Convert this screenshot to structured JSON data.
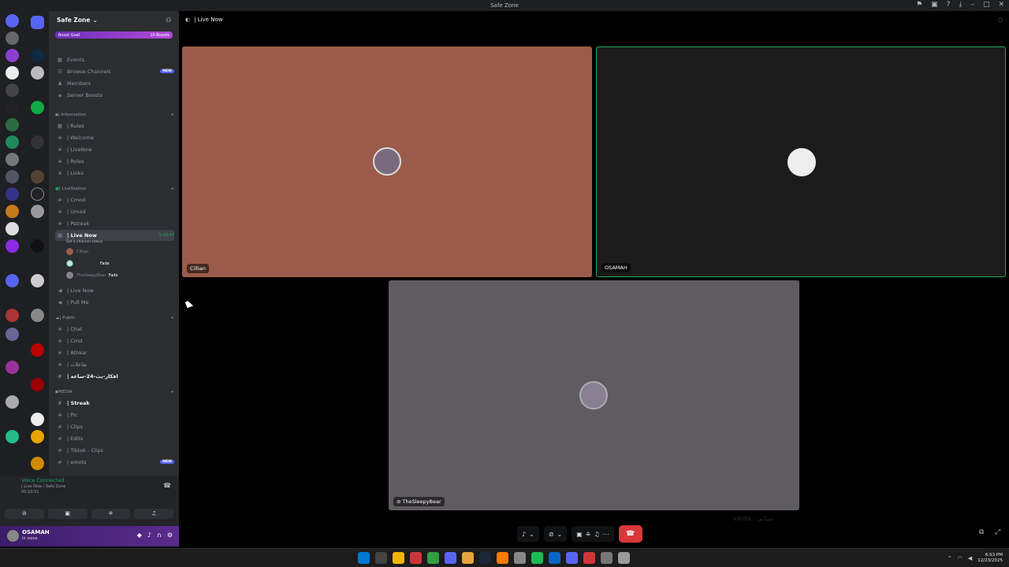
{
  "window": {
    "title": "Safe Zone",
    "controls": [
      "⚑",
      "▣",
      "?",
      "⤓",
      "–",
      "□",
      "✕"
    ]
  },
  "server": {
    "name": "Safe Zone",
    "boost_goal_label": "Boost Goal",
    "boost_count": "10 Boosts",
    "nav": [
      {
        "label": "Events",
        "icon": "calendar-icon"
      },
      {
        "label": "Browse Channels",
        "icon": "browse-icon",
        "badge": "NEW"
      },
      {
        "label": "Members",
        "icon": "members-icon"
      },
      {
        "label": "Server Boosts",
        "icon": "boost-icon"
      }
    ]
  },
  "categories": {
    "information": "| Information",
    "livestation": "| LiveStation",
    "public": "| Public",
    "media": "MEDIA"
  },
  "channels": {
    "rules": "| Rules",
    "welcome": "| Welcome",
    "livenow_text": "| LiveNow",
    "roles": "| Roles",
    "links": "| Links",
    "cmod": "| Cmod",
    "umod": "| Umod",
    "pstreak": "| Pstreak",
    "live_now_voice": "| Live Now",
    "live_now_timer": "5:10:47",
    "live_now_status": "Set a channel status",
    "live_now_2": "| Live Now",
    "pull_me": "| Pull Me",
    "chat": "| Chat",
    "cmd": "| Cmd",
    "athkar": "| Athkar",
    "arabic_1": "| تفاعلات",
    "arabic_2": "| افكار-بث-24-ساعه",
    "streak": "| Streak",
    "pic": "| Pic",
    "clips": "| Clips",
    "edits": "| Edits",
    "tiktok": "| Tiktok - Clips",
    "emots": "| emots",
    "emots_badge": "NEW"
  },
  "voice_users": [
    {
      "name": "Cillian",
      "tag": ""
    },
    {
      "name": "",
      "tag": "Fade"
    },
    {
      "name": "TheSleepyBear",
      "tag": "Fade"
    }
  ],
  "voice_panel": {
    "status": "Voice Connected",
    "channel": "| Live Now / Safe Zone",
    "elapsed": "05:10:51"
  },
  "user_panel": {
    "name": "OSAMAH",
    "status": "In voice"
  },
  "stage": {
    "header": "| Live Now",
    "tiles": [
      {
        "name": "Cillian",
        "bg": "#9b5b4a"
      },
      {
        "name": "OSAMAH",
        "bg": "#1b1b1b",
        "speaking_color": "#23a55a"
      },
      {
        "name": "TheSleepyBear",
        "bg": "#5f5c61"
      }
    ]
  },
  "watermark": "xAida : سنابي",
  "taskbar": {
    "time": "6:53 PM",
    "date": "12/23/2025",
    "app_colors": [
      "#0078d4",
      "#444",
      "#f2b600",
      "#d13438",
      "#2ea043",
      "#5865f2",
      "#e8a33d",
      "#1b2838",
      "#ff7a00",
      "#888",
      "#1db954",
      "#0a66c2",
      "#5865f2",
      "#d13438",
      "#777",
      "#999"
    ]
  }
}
